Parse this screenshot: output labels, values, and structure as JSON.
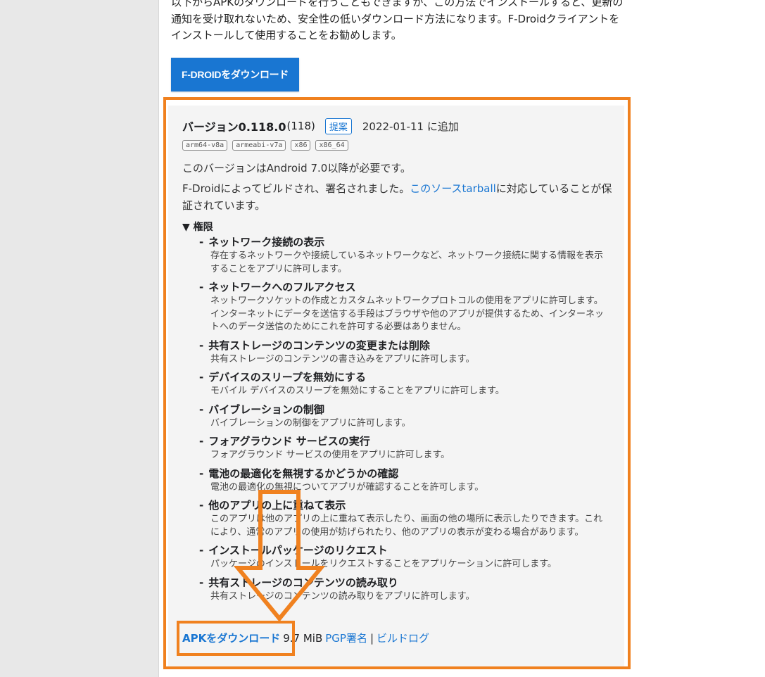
{
  "intro_text": "以下からAPKのダウンロードを行うこともできますが、この方法でインストールすると、更新の通知を受け取れないため、安全性の低いダウンロード方法になります。F-Droidクライアントをインストールして使用することをお勧めします。",
  "fdroid_button": "F-DROIDをダウンロード",
  "version": {
    "title": "バージョン0.118.0",
    "code": "(118)",
    "badge": "提案",
    "added": "2022-01-11 に追加",
    "abis": [
      "arm64-v8a",
      "armeabi-v7a",
      "x86",
      "x86_64"
    ],
    "requirement": "このバージョンはAndroid 7.0以降が必要です。",
    "built_prefix": "F-Droidによってビルドされ、署名されました。",
    "built_link": "このソースtarball",
    "built_suffix": "に対応していることが保証されています。"
  },
  "permissions": {
    "heading": "▼ 権限",
    "items": [
      {
        "name": "ネットワーク接続の表示",
        "desc": "存在するネットワークや接続しているネットワークなど、ネットワーク接続に関する情報を表示することをアプリに許可します。"
      },
      {
        "name": "ネットワークへのフルアクセス",
        "desc": "ネットワークソケットの作成とカスタムネットワークプロトコルの使用をアプリに許可します。インターネットにデータを送信する手段はブラウザや他のアプリが提供するため、インターネットへのデータ送信のためにこれを許可する必要はありません。"
      },
      {
        "name": "共有ストレージのコンテンツの変更または削除",
        "desc": "共有ストレージのコンテンツの書き込みをアプリに許可します。"
      },
      {
        "name": "デバイスのスリープを無効にする",
        "desc": "モバイル デバイスのスリープを無効にすることをアプリに許可します。"
      },
      {
        "name": "バイブレーションの制御",
        "desc": "バイブレーションの制御をアプリに許可します。"
      },
      {
        "name": "フォアグラウンド サービスの実行",
        "desc": "フォアグラウンド サービスの使用をアプリに許可します。"
      },
      {
        "name": "電池の最適化を無視するかどうかの確認",
        "desc": "電池の最適化の無視についてアプリが確認することを許可します。"
      },
      {
        "name": "他のアプリの上に重ねて表示",
        "desc": "このアプリは他のアプリの上に重ねて表示したり、画面の他の場所に表示したりできます。これにより、通常のアプリの使用が妨げられたり、他のアプリの表示が変わる場合があります。"
      },
      {
        "name": "インストールパッケージのリクエスト",
        "desc": "パッケージのインストールをリクエストすることをアプリケーションに許可します。"
      },
      {
        "name": "共有ストレージのコンテンツの読み取り",
        "desc": "共有ストレージのコンテンツの読み取りをアプリに許可します。"
      }
    ]
  },
  "download": {
    "apk_link": "APKをダウンロード",
    "size": "9.7 MiB",
    "pgp_link": "PGP署名",
    "separator": "|",
    "log_link": "ビルドログ"
  },
  "colors": {
    "accent": "#1976d2",
    "highlight": "#f0811f"
  }
}
